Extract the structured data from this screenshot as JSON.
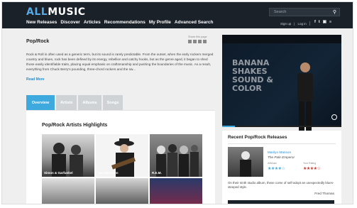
{
  "header": {
    "logo_all": "ALL",
    "logo_music": "MUSIC",
    "nav": [
      "New Releases",
      "Discover",
      "Articles",
      "Recommendations",
      "My Profile",
      "Advanced Search"
    ],
    "search": {
      "placeholder": "Search"
    },
    "signup": "Sign up",
    "login": "Log in",
    "social_icons": [
      "facebook-icon",
      "twitter-icon",
      "instagram-icon",
      "rss-icon"
    ]
  },
  "page": {
    "title": "Pop/Rock",
    "share_label": "Share this page",
    "description": "Rock & Roll is often used as a generic term, but its sound is rarely predictable. From the outset, when the early rockers merged country and blues, rock has been defined by its energy, rebellion and catchy hooks, but as the genre aged, it began to shed those easily identifiable traits, placing equal emphasis on craftsmanship and pushing the boundaries of the music. As a result, everything from Chuck Berry's pounding, three-chord rockers and the sw...",
    "read_more": "Read More"
  },
  "tabs": [
    "Overview",
    "Artists",
    "Albums",
    "Songs"
  ],
  "highlights": {
    "title": "Pop/Rock Artists Highlights",
    "artists": [
      "Simon & Garfunkel",
      "Van Morrison",
      "R.E.M."
    ]
  },
  "video": {
    "overlay_lines": [
      "BANANA",
      "SHAKES",
      "SOUND &",
      "COLOR"
    ]
  },
  "recent": {
    "title": "Recent Pop/Rock Releases",
    "artist": "Marilyn Manson",
    "album": "The Pale Emperor",
    "allmusic_label": "AllMusic",
    "user_label": "Your Rating",
    "allmusic_stars": "★★★★☆",
    "user_stars": "★★★★☆",
    "review": "On their ninth studio album, these come of self-adopt an unexpectedly blues-steeped style.",
    "reviewer": "Fred Thomas"
  },
  "colors": {
    "accent": "#3ea9df",
    "header": "#1b2129",
    "stars_user": "#c8322a",
    "stars_site": "#3ea9df"
  }
}
